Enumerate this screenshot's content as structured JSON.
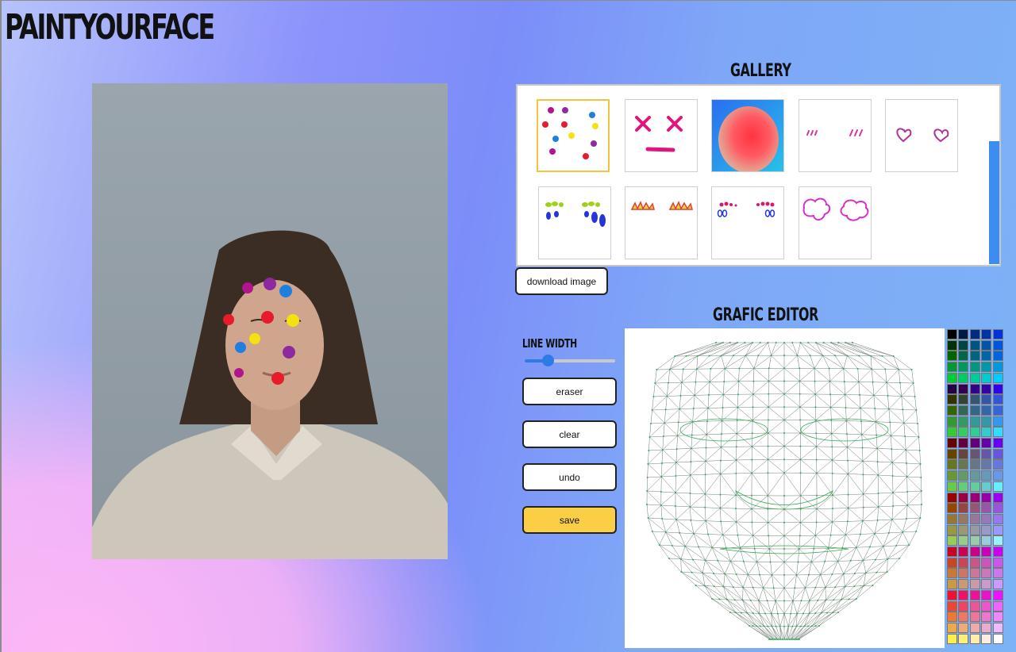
{
  "app": {
    "title": "PAINTYOURFACE"
  },
  "gallery": {
    "heading": "GALLERY",
    "download_label": "download image",
    "items": [
      {
        "name": "flowers"
      },
      {
        "name": "x-eyes"
      },
      {
        "name": "blush-gradient"
      },
      {
        "name": "cheek-lines"
      },
      {
        "name": "hearts"
      },
      {
        "name": "tears"
      },
      {
        "name": "flames"
      },
      {
        "name": "drops"
      },
      {
        "name": "clouds"
      }
    ]
  },
  "editor": {
    "heading": "GRAFIC EDITOR",
    "line_width_label": "LINE WIDTH",
    "line_width_value": 0.25,
    "buttons": {
      "eraser": "eraser",
      "clear": "clear",
      "undo": "undo",
      "save": "save"
    },
    "mesh_color": "#2fa84f"
  },
  "palette": [
    [
      "#000000",
      "#001a44",
      "#002b80",
      "#0033aa",
      "#0033dd"
    ],
    [
      "#003300",
      "#004444",
      "#00557f",
      "#0055aa",
      "#0055dd"
    ],
    [
      "#006600",
      "#00664c",
      "#006680",
      "#0066aa",
      "#0066dd"
    ],
    [
      "#009933",
      "#00995f",
      "#009980",
      "#0099aa",
      "#0099dd"
    ],
    [
      "#00cc33",
      "#00cc66",
      "#00cc99",
      "#00cccc",
      "#00ccff"
    ],
    [
      "#220044",
      "#33004f",
      "#330088",
      "#3300aa",
      "#3300ee"
    ],
    [
      "#333300",
      "#334433",
      "#335577",
      "#3355aa",
      "#3355dd"
    ],
    [
      "#336600",
      "#336655",
      "#336688",
      "#3366aa",
      "#3366dd"
    ],
    [
      "#339933",
      "#339966",
      "#339999",
      "#3399aa",
      "#3399ee"
    ],
    [
      "#33cc33",
      "#33cc66",
      "#33cc99",
      "#33cccc",
      "#33ddff"
    ],
    [
      "#660000",
      "#660044",
      "#660077",
      "#6600aa",
      "#6600ee"
    ],
    [
      "#664400",
      "#664444",
      "#665577",
      "#6655aa",
      "#6655dd"
    ],
    [
      "#667722",
      "#667755",
      "#667788",
      "#6677aa",
      "#6677dd"
    ],
    [
      "#669933",
      "#669966",
      "#669999",
      "#6699bb",
      "#6699ee"
    ],
    [
      "#66cc44",
      "#66cc77",
      "#66cc99",
      "#66cccc",
      "#66eeff"
    ],
    [
      "#990000",
      "#990044",
      "#990077",
      "#9900aa",
      "#9900ee"
    ],
    [
      "#994400",
      "#994444",
      "#995577",
      "#9955aa",
      "#9955dd"
    ],
    [
      "#997733",
      "#997766",
      "#997799",
      "#9977bb",
      "#9977ee"
    ],
    [
      "#999944",
      "#999977",
      "#9999aa",
      "#9999cc",
      "#9999ff"
    ],
    [
      "#99cc55",
      "#99cc88",
      "#99ccaa",
      "#99ccdd",
      "#99eeff"
    ],
    [
      "#cc0022",
      "#cc0055",
      "#cc0088",
      "#cc00bb",
      "#cc00ee"
    ],
    [
      "#cc4422",
      "#cc4455",
      "#cc5588",
      "#cc55bb",
      "#cc55ee"
    ],
    [
      "#cc7733",
      "#cc7766",
      "#cc7799",
      "#cc77bb",
      "#cc77ee"
    ],
    [
      "#cc9944",
      "#cc9977",
      "#cc99aa",
      "#cc99cc",
      "#cc99ff"
    ],
    [
      "#ee1133",
      "#ee1166",
      "#ee1199",
      "#ee11cc",
      "#ee11ff"
    ],
    [
      "#ee4433",
      "#ee4466",
      "#ee5599",
      "#ee55cc",
      "#ee66ff"
    ],
    [
      "#ee7733",
      "#ee7766",
      "#ee7799",
      "#ee77cc",
      "#ee88ff"
    ],
    [
      "#eeaa44",
      "#eeaa77",
      "#eeaaaa",
      "#eeaacc",
      "#eebbff"
    ],
    [
      "#ffee44",
      "#ffee77",
      "#ffeeaa",
      "#ffeedd",
      "#ffffff"
    ]
  ]
}
